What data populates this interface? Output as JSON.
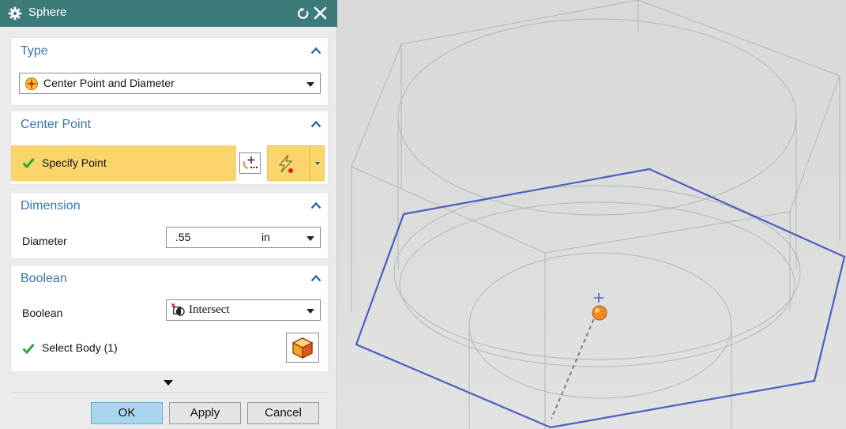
{
  "dialog": {
    "title": "Sphere",
    "sections": {
      "type": {
        "header": "Type",
        "method_value": "Center Point and Diameter"
      },
      "center_point": {
        "header": "Center Point",
        "specify_point_label": "Specify Point"
      },
      "dimension": {
        "header": "Dimension",
        "diameter_label": "Diameter",
        "diameter_value": ".55",
        "unit_value": "in"
      },
      "boolean": {
        "header": "Boolean",
        "boolean_label": "Boolean",
        "boolean_value": "Intersect",
        "select_body_label": "Select Body (1)"
      }
    },
    "buttons": {
      "ok": "OK",
      "apply": "Apply",
      "cancel": "Cancel"
    },
    "colors": {
      "title_bar": "#3d7b7b",
      "section_header_text": "#3a75a8",
      "active_row": "#fad56b",
      "check": "#2aa83a",
      "ok_button": "#a7d4ef"
    }
  },
  "viewport": {
    "colors": {
      "background": "#dcdcdc",
      "wireframe_edges": "#a9b8b8",
      "selected_face_outline": "#4a5fc1",
      "sphere": "#f08a1e",
      "dashed_line": "#8a7f5a"
    }
  }
}
